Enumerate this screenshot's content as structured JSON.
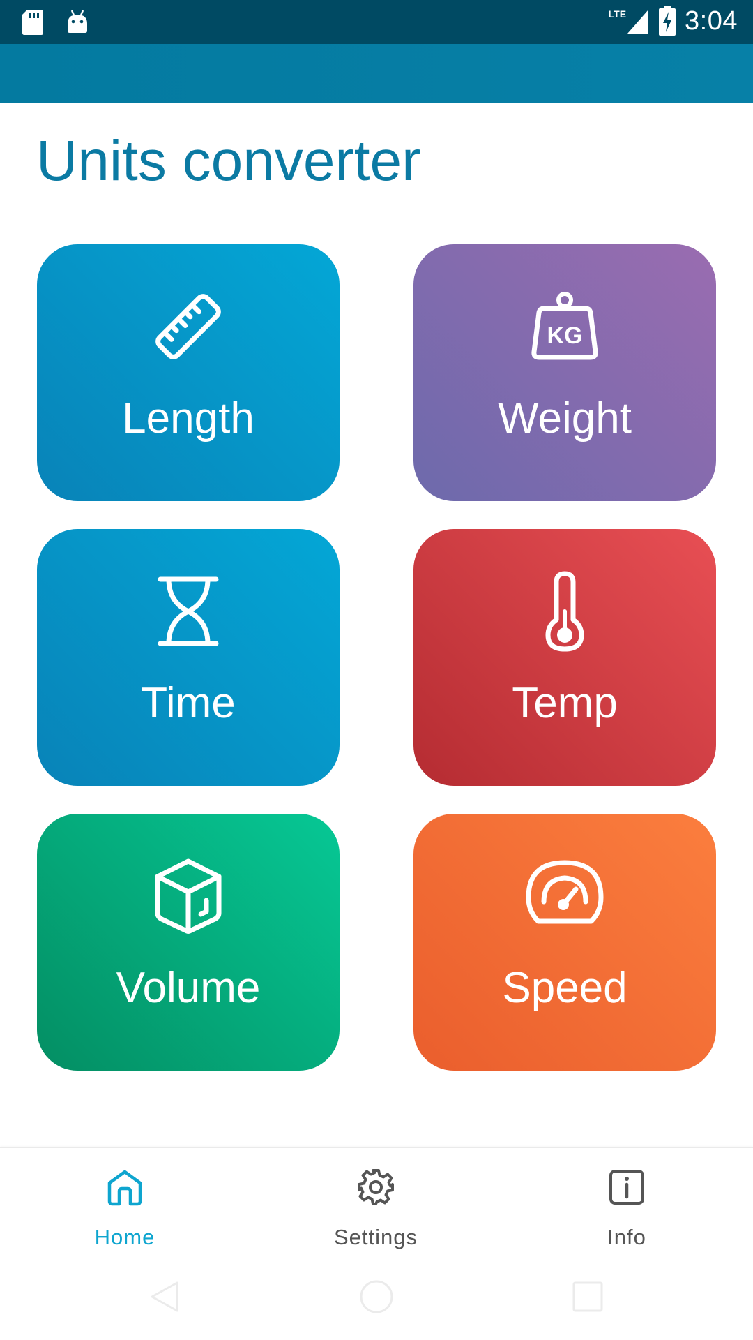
{
  "status_bar": {
    "time": "3:04",
    "network": "LTE",
    "icons": [
      "sd-card-icon",
      "android-icon",
      "signal-icon",
      "battery-charging-icon"
    ]
  },
  "page": {
    "title": "Units converter"
  },
  "tiles": [
    {
      "label": "Length",
      "icon": "ruler-icon"
    },
    {
      "label": "Weight",
      "icon": "kg-weight-icon"
    },
    {
      "label": "Time",
      "icon": "hourglass-icon"
    },
    {
      "label": "Temp",
      "icon": "thermometer-icon"
    },
    {
      "label": "Volume",
      "icon": "cube-icon"
    },
    {
      "label": "Speed",
      "icon": "speedometer-icon"
    }
  ],
  "bottom_nav": {
    "items": [
      {
        "label": "Home",
        "icon": "home-icon",
        "active": true
      },
      {
        "label": "Settings",
        "icon": "gear-icon",
        "active": false
      },
      {
        "label": "Info",
        "icon": "info-icon",
        "active": false
      }
    ]
  },
  "colors": {
    "status_bar": "#004a63",
    "app_bar": "#047aa0",
    "title": "#0b7aa3",
    "nav_active": "#0ea5cf",
    "length_tile": "#04a7d6",
    "weight_tile": "#9a6cb0",
    "time_tile": "#04a7d6",
    "temp_tile": "#e84f54",
    "volume_tile": "#06c895",
    "speed_tile": "#fb7e3e"
  }
}
